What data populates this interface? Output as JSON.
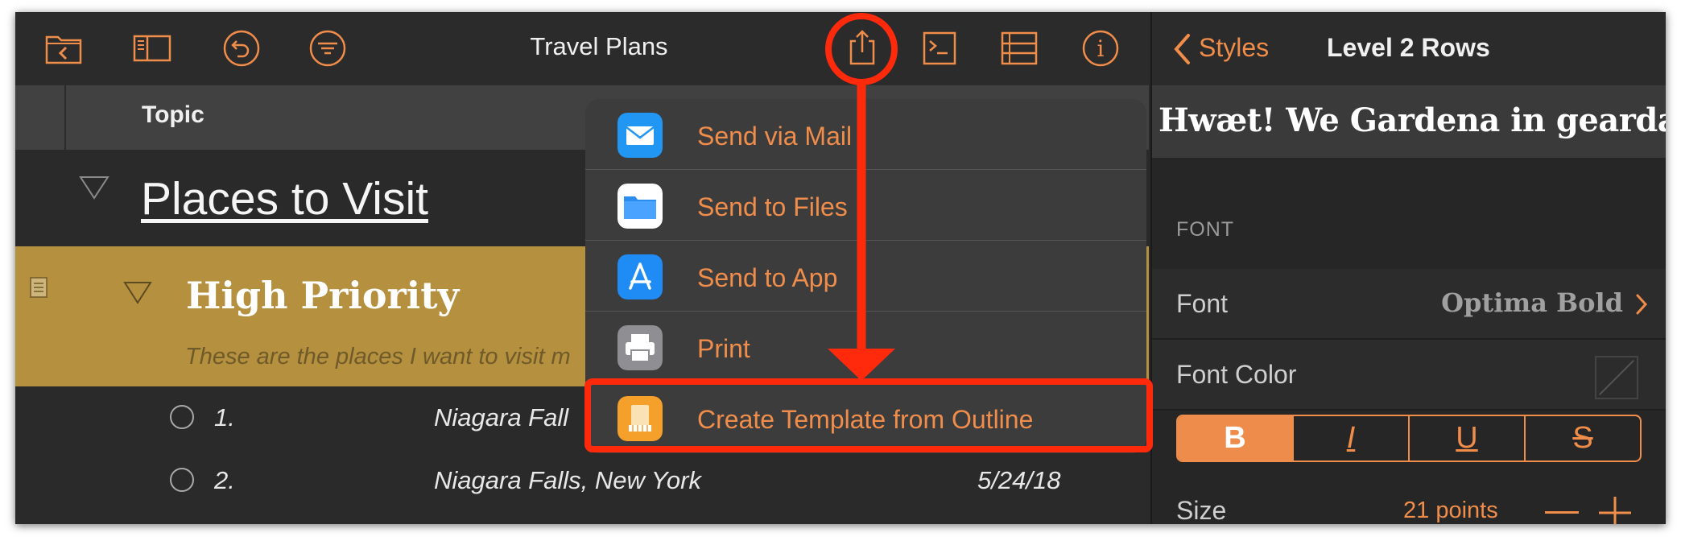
{
  "toolbar": {
    "title": "Travel Plans",
    "icons": [
      "folder-back-icon",
      "sidebar-icon",
      "undo-icon",
      "filter-icon",
      "share-icon",
      "console-icon",
      "columns-icon",
      "info-icon"
    ]
  },
  "outline": {
    "column_header": "Topic",
    "rows": {
      "places": "Places to Visit",
      "high_priority": "High Priority",
      "high_priority_note": "These are the places I want to visit m",
      "items": [
        {
          "num": "1.",
          "place": "Niagara Fall",
          "date": ""
        },
        {
          "num": "2.",
          "place": "Niagara Falls, New York",
          "date": "5/24/18"
        }
      ]
    }
  },
  "share_menu": {
    "items": [
      {
        "label": "Send via Mail",
        "icon": "mail-icon"
      },
      {
        "label": "Send to Files",
        "icon": "files-icon"
      },
      {
        "label": "Send to App",
        "icon": "app-store-icon"
      },
      {
        "label": "Print",
        "icon": "print-icon"
      },
      {
        "label": "Create Template from Outline",
        "icon": "template-icon"
      }
    ]
  },
  "inspector": {
    "back_label": "Styles",
    "title": "Level 2 Rows",
    "preview": "Hwæt! We Gardena in geardagum",
    "section_font": "FONT",
    "font_label": "Font",
    "font_value": "Optima Bold",
    "font_color_label": "Font Color",
    "style_buttons": {
      "bold": "B",
      "italic": "I",
      "underline": "U",
      "strike": "S"
    },
    "size_label": "Size",
    "size_value": "21 points"
  },
  "colors": {
    "accent": "#f08d4a",
    "highlight_row": "#b5903f",
    "annotation": "#ff2a0b",
    "background": "#2a2a2b"
  }
}
